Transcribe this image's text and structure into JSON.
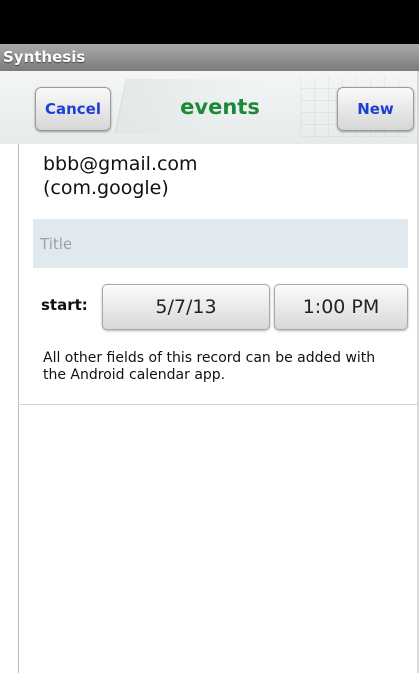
{
  "app": {
    "title": "Synthesis"
  },
  "header": {
    "cancel_label": "Cancel",
    "title": "events",
    "new_label": "New"
  },
  "account": {
    "email": "bbb@gmail.com",
    "type": "(com.google)"
  },
  "form": {
    "title_placeholder": "Title",
    "title_value": "",
    "start_label": "start:",
    "start_date": "5/7/13",
    "start_time": "1:00 PM"
  },
  "note": "All other fields of this record can be added with the Android calendar app.",
  "colors": {
    "accent_title": "#1a8a3a",
    "button_text": "#1e3fd6"
  }
}
